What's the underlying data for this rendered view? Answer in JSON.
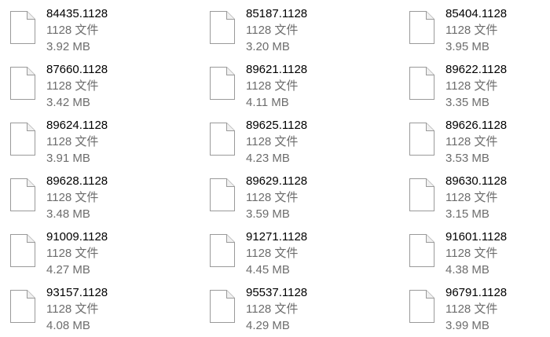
{
  "files": [
    {
      "name": "84435.1128",
      "type": "1128 文件",
      "size": "3.92 MB",
      "icon": "file-icon"
    },
    {
      "name": "85187.1128",
      "type": "1128 文件",
      "size": "3.20 MB",
      "icon": "file-icon"
    },
    {
      "name": "85404.1128",
      "type": "1128 文件",
      "size": "3.95 MB",
      "icon": "file-icon"
    },
    {
      "name": "87660.1128",
      "type": "1128 文件",
      "size": "3.42 MB",
      "icon": "file-icon"
    },
    {
      "name": "89621.1128",
      "type": "1128 文件",
      "size": "4.11 MB",
      "icon": "file-icon"
    },
    {
      "name": "89622.1128",
      "type": "1128 文件",
      "size": "3.35 MB",
      "icon": "file-icon"
    },
    {
      "name": "89624.1128",
      "type": "1128 文件",
      "size": "3.91 MB",
      "icon": "file-icon"
    },
    {
      "name": "89625.1128",
      "type": "1128 文件",
      "size": "4.23 MB",
      "icon": "file-icon"
    },
    {
      "name": "89626.1128",
      "type": "1128 文件",
      "size": "3.53 MB",
      "icon": "file-icon"
    },
    {
      "name": "89628.1128",
      "type": "1128 文件",
      "size": "3.48 MB",
      "icon": "file-icon"
    },
    {
      "name": "89629.1128",
      "type": "1128 文件",
      "size": "3.59 MB",
      "icon": "file-icon"
    },
    {
      "name": "89630.1128",
      "type": "1128 文件",
      "size": "3.15 MB",
      "icon": "file-icon"
    },
    {
      "name": "91009.1128",
      "type": "1128 文件",
      "size": "4.27 MB",
      "icon": "file-icon"
    },
    {
      "name": "91271.1128",
      "type": "1128 文件",
      "size": "4.45 MB",
      "icon": "file-icon"
    },
    {
      "name": "91601.1128",
      "type": "1128 文件",
      "size": "4.38 MB",
      "icon": "file-icon"
    },
    {
      "name": "93157.1128",
      "type": "1128 文件",
      "size": "4.08 MB",
      "icon": "file-icon"
    },
    {
      "name": "95537.1128",
      "type": "1128 文件",
      "size": "4.29 MB",
      "icon": "file-icon"
    },
    {
      "name": "96791.1128",
      "type": "1128 文件",
      "size": "3.99 MB",
      "icon": "file-icon"
    }
  ]
}
